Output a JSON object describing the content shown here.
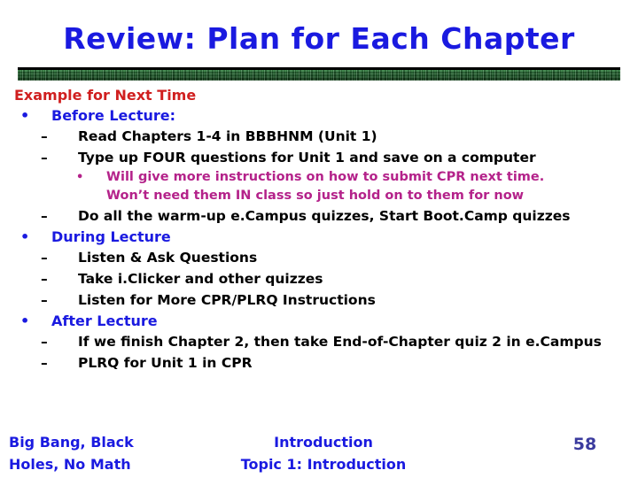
{
  "slide": {
    "title": "Review: Plan for Each Chapter",
    "heading": "Example for Next Time",
    "bullets": {
      "dot": "•",
      "dash": "–"
    },
    "items": [
      {
        "level": 1,
        "text": "Before Lecture:"
      },
      {
        "level": 2,
        "text": "Read Chapters 1-4 in BBBHNM (Unit 1)"
      },
      {
        "level": 2,
        "text": "Type up FOUR questions for Unit 1 and save on a computer"
      },
      {
        "level": 3,
        "text": "Will give more instructions on how to submit CPR next time.",
        "text2": "Won’t need them IN class so just hold on to them for now"
      },
      {
        "level": 2,
        "text": "Do all the warm-up e.Campus quizzes, Start Boot.Camp quizzes"
      },
      {
        "level": 1,
        "text": "During Lecture"
      },
      {
        "level": 2,
        "text": "Listen & Ask Questions"
      },
      {
        "level": 2,
        "text": "Take i.Clicker and other quizzes"
      },
      {
        "level": 2,
        "text": "Listen for More CPR/PLRQ Instructions"
      },
      {
        "level": 1,
        "text": "After Lecture"
      },
      {
        "level": 2,
        "text": "If we finish Chapter 2, then take End-of-Chapter quiz 2 in e.Campus",
        "wrap": true
      },
      {
        "level": 2,
        "text": "PLRQ for Unit 1 in CPR"
      }
    ]
  },
  "footer": {
    "left_line1": "Big Bang, Black",
    "left_line2": "Holes, No Math",
    "center_line1": "Introduction",
    "center_line2": "Topic 1: Introduction",
    "page_number": "58"
  },
  "colors": {
    "title_blue": "#1a1ae0",
    "heading_red": "#d01f1f",
    "body_black": "#000000",
    "accent_magenta": "#b4228a",
    "rule_green": "#1d5b2a",
    "page_number_blue": "#3b3b9e"
  }
}
